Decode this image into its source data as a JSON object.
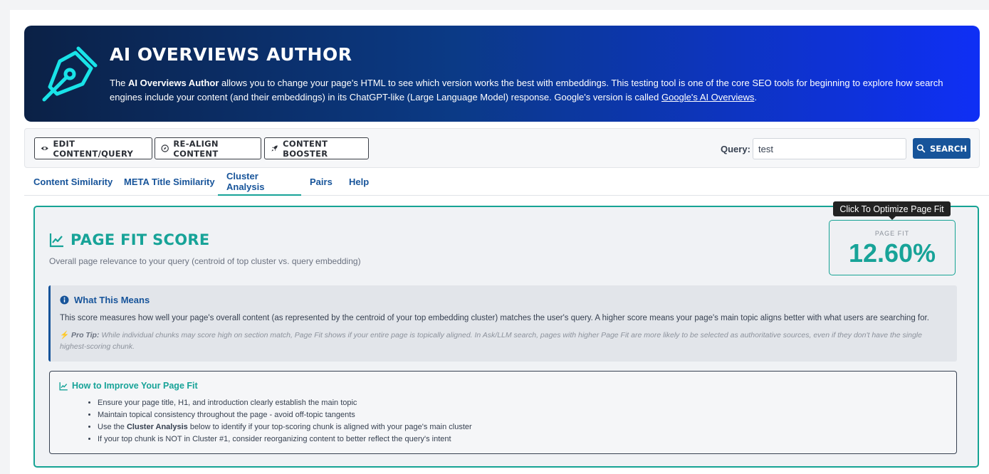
{
  "hero": {
    "title": "AI OVERVIEWS AUTHOR",
    "desc_before": "The ",
    "desc_bold": "AI Overviews Author",
    "desc_after": " allows you to change your page's HTML to see which version works the best with embeddings. This testing tool is one of the core SEO tools for beginning to explore how search engines include your content (and their embeddings) in its ChatGPT-like (Large Language Model) response. Google's version is called ",
    "desc_link": "Google's AI Overviews",
    "desc_end": "."
  },
  "toolbar": {
    "edit_label": "EDIT CONTENT/QUERY",
    "realign_label": "RE-ALIGN CONTENT",
    "booster_label": "CONTENT BOOSTER",
    "query_label": "Query:",
    "query_value": "test",
    "search_label": "SEARCH"
  },
  "tabs": [
    "Content Similarity",
    "META Title Similarity",
    "Cluster Analysis",
    "Pairs",
    "Help"
  ],
  "card": {
    "title": "PAGE FIT SCORE",
    "subtitle": "Overall page relevance to your query (centroid of top cluster vs. query embedding)",
    "tooltip": "Click To Optimize Page Fit",
    "fit_label": "PAGE FIT",
    "fit_value": "12.60%",
    "info_title": "What This Means",
    "info_text": "This score measures how well your page's overall content (as represented by the centroid of your top embedding cluster) matches the user's query. A higher score means your page's main topic aligns better with what users are searching for.",
    "tip_label": "Pro Tip:",
    "tip_text": " While individual chunks may score high on section match, Page Fit shows if your entire page is topically aligned. In Ask/LLM search, pages with higher Page Fit are more likely to be selected as authoritative sources, even if they don't have the single highest-scoring chunk.",
    "improve_title": "How to Improve Your Page Fit",
    "improve_items": {
      "i1": "Ensure your page title, H1, and introduction clearly establish the main topic",
      "i2": "Maintain topical consistency throughout the page - avoid off-topic tangents",
      "i3_before": "Use the ",
      "i3_bold": "Cluster Analysis",
      "i3_after": " below to identify if your top-scoring chunk is aligned with your page's main cluster",
      "i4": "If your top chunk is NOT in Cluster #1, consider reorganizing content to better reflect the query's intent"
    }
  },
  "colors": {
    "brand": "#17549a",
    "accent": "#17a398"
  }
}
